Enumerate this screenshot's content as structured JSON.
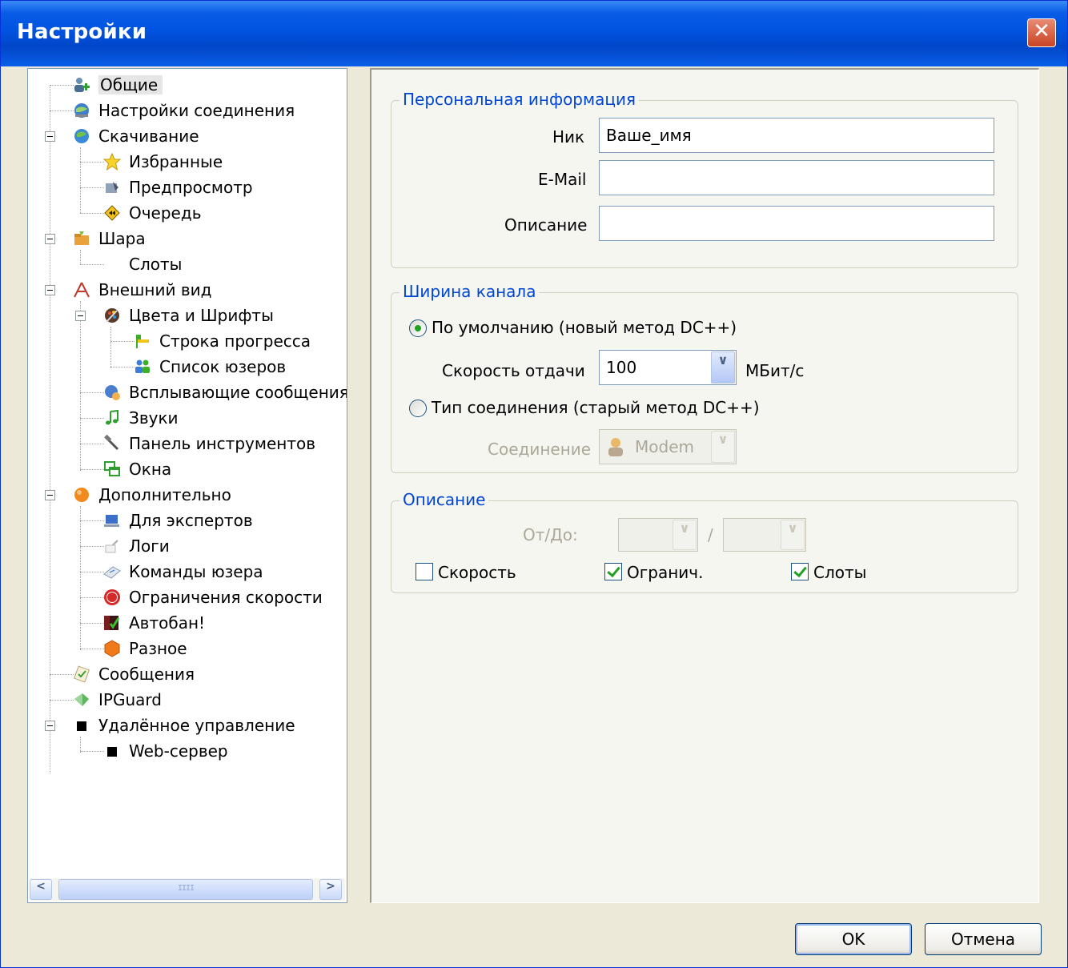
{
  "window": {
    "title": "Настройки",
    "close_glyph": "✕"
  },
  "tree": {
    "items": [
      {
        "label": "Общие",
        "icon": "users-icon"
      },
      {
        "label": "Настройки соединения",
        "icon": "globe-network-icon"
      },
      {
        "label": "Скачивание",
        "icon": "download-globe-icon"
      },
      {
        "label": "Избранные",
        "icon": "star-icon"
      },
      {
        "label": "Предпросмотр",
        "icon": "preview-icon"
      },
      {
        "label": "Очередь",
        "icon": "queue-icon"
      },
      {
        "label": "Шара",
        "icon": "share-folder-icon"
      },
      {
        "label": "Слоты",
        "icon": ""
      },
      {
        "label": "Внешний вид",
        "icon": "appearance-icon"
      },
      {
        "label": "Цвета и Шрифты",
        "icon": "palette-icon"
      },
      {
        "label": "Строка прогресса",
        "icon": "progress-bar-icon"
      },
      {
        "label": "Список юзеров",
        "icon": "user-list-icon"
      },
      {
        "label": "Всплывающие сообщения",
        "icon": "popup-icon"
      },
      {
        "label": "Звуки",
        "icon": "music-note-icon"
      },
      {
        "label": "Панель инструментов",
        "icon": "tools-icon"
      },
      {
        "label": "Окна",
        "icon": "windows-icon"
      },
      {
        "label": "Дополнительно",
        "icon": "advanced-icon"
      },
      {
        "label": "Для экспертов",
        "icon": "expert-icon"
      },
      {
        "label": "Логи",
        "icon": "logs-icon"
      },
      {
        "label": "Команды юзера",
        "icon": "user-commands-icon"
      },
      {
        "label": "Ограничения скорости",
        "icon": "speed-limit-icon"
      },
      {
        "label": "Автобан!",
        "icon": "autoban-icon"
      },
      {
        "label": "Разное",
        "icon": "misc-icon"
      },
      {
        "label": "Сообщения",
        "icon": "messages-icon"
      },
      {
        "label": "IPGuard",
        "icon": "ipguard-icon"
      },
      {
        "label": "Удалённое управление",
        "icon": "square-icon"
      },
      {
        "label": "Web-сервер",
        "icon": "square-icon"
      }
    ],
    "scroll_left": "<",
    "scroll_right": ">",
    "scroll_grip": "IIII"
  },
  "personal": {
    "legend": "Персональная информация",
    "nick_label": "Ник",
    "nick_value": "Ваше_имя",
    "email_label": "E-Mail",
    "email_value": "",
    "desc_label": "Описание",
    "desc_value": ""
  },
  "bandwidth": {
    "legend": "Ширина канала",
    "default_radio": "По умолчанию (новый метод DC++)",
    "upload_label": "Скорость отдачи",
    "upload_value": "100",
    "unit": "МБит/с",
    "type_radio": "Тип соединения (старый метод DC++)",
    "connection_label": "Соединение",
    "connection_value": "Modem"
  },
  "description": {
    "legend": "Описание",
    "fromto_label": "От/До:",
    "separator": "/",
    "speed_label": "Скорость",
    "limit_label": "Огранич.",
    "slots_label": "Слоты",
    "speed_checked": false,
    "limit_checked": true,
    "slots_checked": true
  },
  "buttons": {
    "ok": "OK",
    "cancel": "Отмена"
  },
  "colors": {
    "title_bar": "#0053e1",
    "legend_text": "#0046d5",
    "check_green": "#21a121"
  }
}
